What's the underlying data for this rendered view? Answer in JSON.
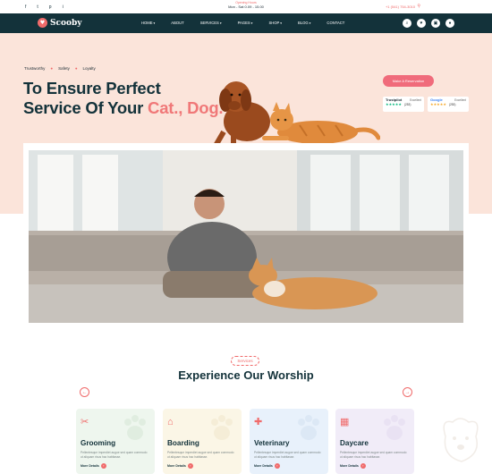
{
  "topbar": {
    "socials": [
      "f",
      "t",
      "p",
      "i"
    ],
    "open_label": "Opening Hours",
    "open_value": "Mon - Sat 0.09 - 15.00",
    "phone": "+1 (541) 754-3010"
  },
  "nav": {
    "logo": "Scooby",
    "items": [
      {
        "label": "HOME",
        "dropdown": true
      },
      {
        "label": "ABOUT",
        "dropdown": false
      },
      {
        "label": "SERVICES",
        "dropdown": true
      },
      {
        "label": "PAGES",
        "dropdown": true
      },
      {
        "label": "SHOP",
        "dropdown": true
      },
      {
        "label": "BLOG",
        "dropdown": true
      },
      {
        "label": "CONTACT",
        "dropdown": false
      }
    ],
    "icons": [
      "search-icon",
      "heart-icon",
      "cart-icon",
      "user-icon"
    ]
  },
  "hero": {
    "tags": [
      "Trustworthy",
      "Safety",
      "Loyalty"
    ],
    "title_line1": "To Ensure Perfect",
    "title_line2_prefix": "Service Of Your ",
    "title_line2_accent": "Cat., Dog.",
    "cta": "Make A Reservation",
    "ratings": [
      {
        "brand": "Trustpilot",
        "label": "Excellent",
        "count": "(253)"
      },
      {
        "brand": "Google",
        "label": "Excellent",
        "count": "(253)"
      }
    ]
  },
  "services": {
    "tag": "Services",
    "title": "Experience Our Worship",
    "cards": [
      {
        "title": "Grooming",
        "desc": "Pellentesque imperdiet augue sed quam commodo ut aliquam risus hac habitasse.",
        "more": "More Details",
        "bg": "#eef6ee"
      },
      {
        "title": "Boarding",
        "desc": "Pellentesque imperdiet augue sed quam commodo ut aliquam risus hac habitasse.",
        "more": "More Details",
        "bg": "#fbf6e6"
      },
      {
        "title": "Veterinary",
        "desc": "Pellentesque imperdiet augue sed quam commodo ut aliquam risus hac habitasse.",
        "more": "More Details",
        "bg": "#e8f1fb"
      },
      {
        "title": "Daycare",
        "desc": "Pellentesque imperdiet augue sed quam commodo ut aliquam risus hac habitasse.",
        "more": "More Details",
        "bg": "#f1ecf8"
      }
    ]
  },
  "colors": {
    "accent": "#f06b6b",
    "dark": "#13323a",
    "hero_bg": "#fbe4da"
  }
}
